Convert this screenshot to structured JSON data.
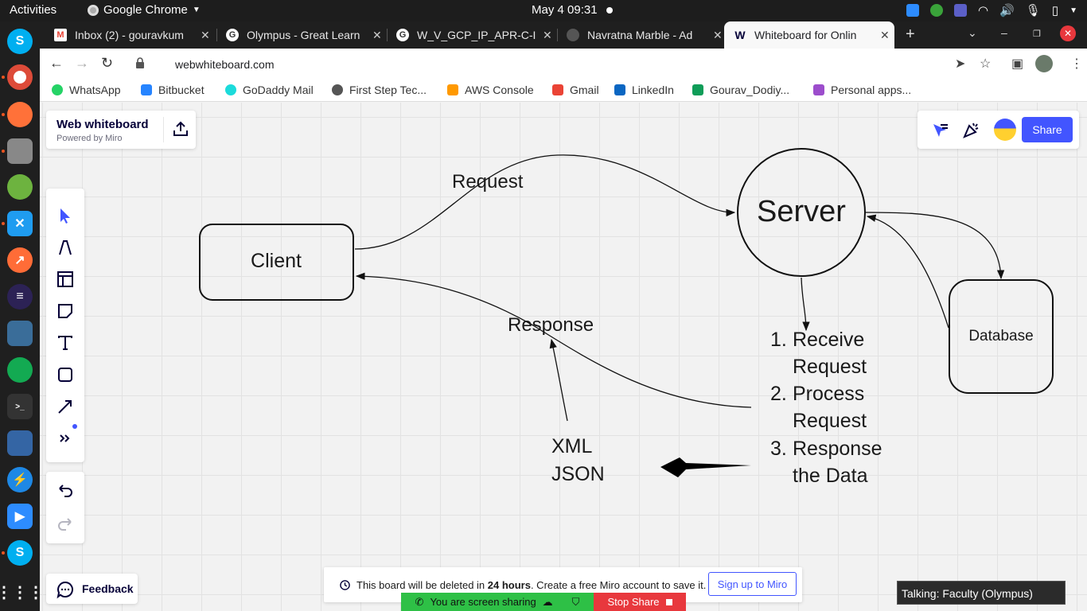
{
  "topbar": {
    "activities": "Activities",
    "app": "Google Chrome",
    "clock": "May 4  09:31"
  },
  "tabs": [
    {
      "title": "Inbox (2) - gouravkum",
      "favicon": "gmail-icon"
    },
    {
      "title": "Olympus - Great Learn",
      "favicon": "google-icon"
    },
    {
      "title": "W_V_GCP_IP_APR-C-I",
      "favicon": "google-icon"
    },
    {
      "title": "Navratna Marble - Ad",
      "favicon": "globe-icon"
    },
    {
      "title": "Whiteboard for Onlin",
      "favicon": "miro-w-icon"
    }
  ],
  "address": {
    "url": "webwhiteboard.com"
  },
  "bookmarks": [
    {
      "label": "WhatsApp",
      "color": "#25d366"
    },
    {
      "label": "Bitbucket",
      "color": "#2684ff"
    },
    {
      "label": "GoDaddy Mail",
      "color": "#1bdbdb"
    },
    {
      "label": "First Step Tec...",
      "color": "#555555"
    },
    {
      "label": "AWS Console",
      "color": "#ff9900"
    },
    {
      "label": "Gmail",
      "color": "#ea4335"
    },
    {
      "label": "LinkedIn",
      "color": "#0a66c2"
    },
    {
      "label": "Gourav_Dodiy...",
      "color": "#0f9d58"
    },
    {
      "label": "Personal apps...",
      "color": "#9c4dcc"
    }
  ],
  "board": {
    "title": "Web whiteboard",
    "subtitle": "Powered by Miro",
    "share": "Share",
    "feedback": "Feedback"
  },
  "diagram": {
    "client": "Client",
    "server": "Server",
    "database": "Database",
    "request": "Request",
    "response": "Response",
    "xml": "XML",
    "json": "JSON",
    "steps": [
      {
        "num": "1.",
        "line1": "Receive",
        "line2": "Request"
      },
      {
        "num": "2.",
        "line1": "Process",
        "line2": "Request"
      },
      {
        "num": "3.",
        "line1": "Response",
        "line2": "the Data"
      }
    ]
  },
  "notice": {
    "pre": "This board will be deleted in ",
    "bold": "24 hours",
    "post": ". Create a free Miro account to save it.",
    "signup": "Sign up to Miro"
  },
  "screenshare": {
    "sharing": "You are screen sharing",
    "stop": "Stop Share"
  },
  "talking": "Talking: Faculty (Olympus)",
  "colors": {
    "accent": "#4255ff",
    "share_green": "#2ec046",
    "stop_red": "#e8383d"
  }
}
